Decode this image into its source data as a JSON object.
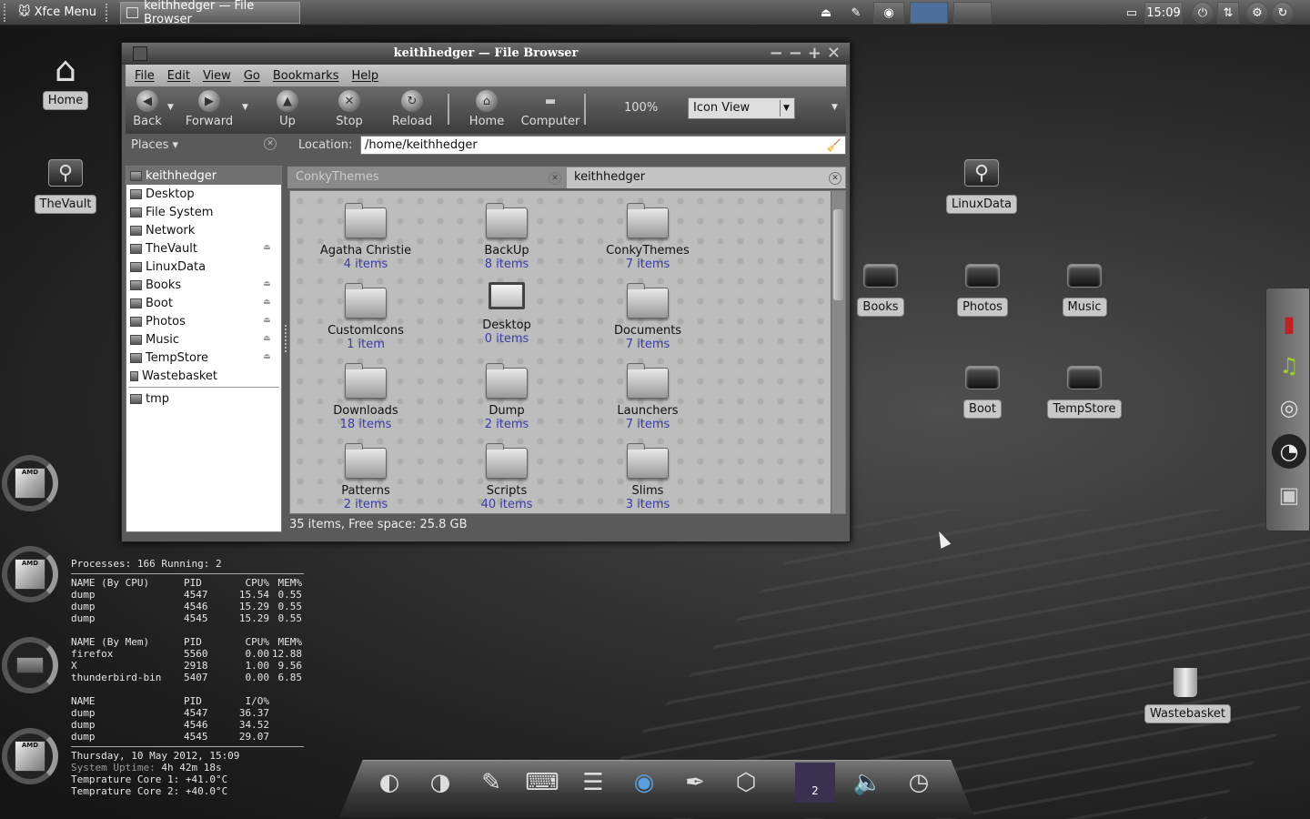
{
  "panel": {
    "menu_label": "Xfce Menu",
    "task_title": "keithhedger — File Browser",
    "clock": "15:09"
  },
  "desktop_icons": [
    {
      "label": "Home",
      "icon": "home-icon"
    },
    {
      "label": "TheVault",
      "icon": "usb-drive-icon"
    },
    {
      "label": "LinuxData",
      "icon": "usb-drive-icon"
    },
    {
      "label": "Books",
      "icon": "drive-icon"
    },
    {
      "label": "Photos",
      "icon": "drive-icon"
    },
    {
      "label": "Music",
      "icon": "drive-icon"
    },
    {
      "label": "Boot",
      "icon": "drive-icon"
    },
    {
      "label": "TempStore",
      "icon": "drive-icon"
    },
    {
      "label": "Wastebasket",
      "icon": "trash-icon"
    }
  ],
  "window": {
    "title": "keithhedger — File Browser",
    "menu": [
      "File",
      "Edit",
      "View",
      "Go",
      "Bookmarks",
      "Help"
    ],
    "toolbar": {
      "back": "Back",
      "forward": "Forward",
      "up": "Up",
      "stop": "Stop",
      "reload": "Reload",
      "home": "Home",
      "computer": "Computer",
      "zoom": "100%",
      "view": "Icon View"
    },
    "places_label": "Places",
    "location_label": "Location:",
    "location_value": "/home/keithhedger",
    "sidebar": [
      "keithhedger",
      "Desktop",
      "File System",
      "Network",
      "TheVault",
      "LinuxData",
      "Books",
      "Boot",
      "Photos",
      "Music",
      "TempStore",
      "Wastebasket",
      "tmp"
    ],
    "tabs": [
      "ConkyThemes",
      "keithhedger"
    ],
    "files": [
      {
        "name": "Agatha Christie",
        "count": "4 items"
      },
      {
        "name": "BackUp",
        "count": "8 items"
      },
      {
        "name": "ConkyThemes",
        "count": "7 items"
      },
      {
        "name": "CustomIcons",
        "count": "1 item"
      },
      {
        "name": "Desktop",
        "count": "0 items"
      },
      {
        "name": "Documents",
        "count": "7 items"
      },
      {
        "name": "Downloads",
        "count": "18 items"
      },
      {
        "name": "Dump",
        "count": "2 items"
      },
      {
        "name": "Launchers",
        "count": "7 items"
      },
      {
        "name": "Patterns",
        "count": "2 items"
      },
      {
        "name": "Scripts",
        "count": "40 items"
      },
      {
        "name": "Slims",
        "count": "3 items"
      }
    ],
    "status": "35 items, Free space: 25.8 GB"
  },
  "conky": {
    "processes": "Processes: 166  Running: 2",
    "cpu_header": [
      "NAME (By CPU)",
      "PID",
      "CPU%",
      "MEM%"
    ],
    "cpu_rows": [
      [
        "dump",
        "4547",
        "15.54",
        "0.55"
      ],
      [
        "dump",
        "4546",
        "15.29",
        "0.55"
      ],
      [
        "dump",
        "4545",
        "15.29",
        "0.55"
      ]
    ],
    "mem_header": [
      "NAME (By Mem)",
      "PID",
      "CPU%",
      "MEM%"
    ],
    "mem_rows": [
      [
        "firefox",
        "5560",
        "0.00",
        "12.88"
      ],
      [
        "X",
        "2918",
        "1.00",
        "9.56"
      ],
      [
        "thunderbird-bin",
        "5407",
        "0.00",
        "6.85"
      ]
    ],
    "io_header": [
      "NAME",
      "PID",
      "I/O%"
    ],
    "io_rows": [
      [
        "dump",
        "4547",
        "36.37"
      ],
      [
        "dump",
        "4546",
        "34.52"
      ],
      [
        "dump",
        "4545",
        "29.07"
      ]
    ],
    "date": "Thursday, 10 May 2012, 15:09",
    "uptime_label": "System Uptime:",
    "uptime": "4h 42m 18s",
    "core1": "Temprature Core 1: +41.0°C",
    "core2": "Temprature Core 2: +40.0°C"
  },
  "chip_labels": [
    "AMD",
    "AMD",
    "AMD"
  ],
  "dock_badge": "2"
}
